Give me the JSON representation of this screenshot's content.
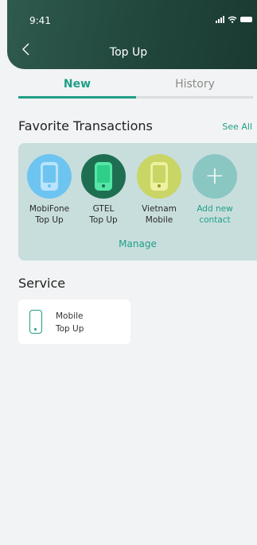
{
  "status_bar": {
    "time": "9:41"
  },
  "header": {
    "title": "Top Up"
  },
  "tabs": [
    {
      "label": "New",
      "active": true
    },
    {
      "label": "History",
      "active": false
    }
  ],
  "favorites": {
    "title": "Favorite Transactions",
    "see_all": "See All",
    "items": [
      {
        "line1": "MobiFone",
        "line2": "Top Up",
        "color": "#6ec4f0",
        "icon": "phone-icon"
      },
      {
        "line1": "GTEL",
        "line2": "Top Up",
        "color": "#1e6e52",
        "icon": "phone-icon"
      },
      {
        "line1": "Vietnam",
        "line2": "Mobile",
        "color": "#c9d564",
        "icon": "phone-icon"
      },
      {
        "line1": "Add new",
        "line2": "contact",
        "color": "#8ac7c2",
        "icon": "plus-icon"
      }
    ],
    "manage": "Manage"
  },
  "service": {
    "title": "Service",
    "items": [
      {
        "line1": "Mobile",
        "line2": "Top Up",
        "icon": "mobile-phone-icon"
      }
    ]
  },
  "colors": {
    "accent": "#1f9f86",
    "header": "#21463c"
  }
}
